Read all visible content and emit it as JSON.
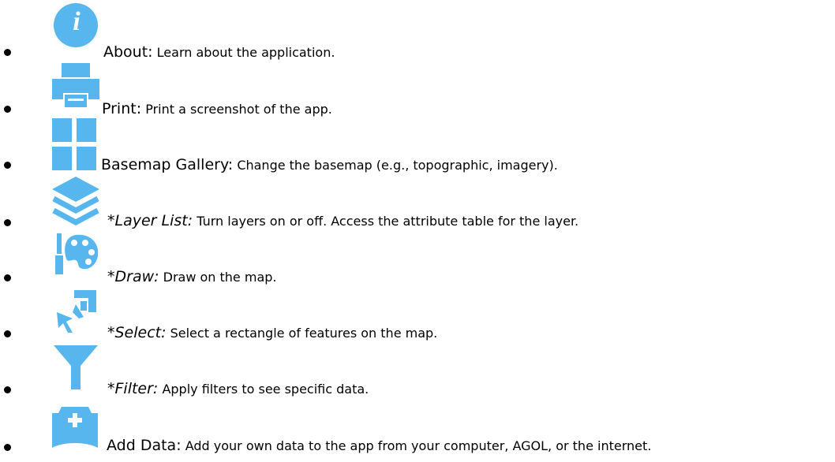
{
  "accent_color": "#58b6ef",
  "items": [
    {
      "icon": "info-icon",
      "name": "About:",
      "italic": false,
      "description": "Learn about the application."
    },
    {
      "icon": "print-icon",
      "name": "Print:",
      "italic": false,
      "description": "Print a screenshot of the app."
    },
    {
      "icon": "basemap-gallery-icon",
      "name": "Basemap Gallery:",
      "italic": false,
      "description": "Change the basemap (e.g., topographic, imagery)."
    },
    {
      "icon": "layers-icon",
      "name": "*Layer List:",
      "italic": true,
      "description": "Turn layers on or off. Access the attribute table for the layer."
    },
    {
      "icon": "draw-palette-icon",
      "name": "*Draw:",
      "italic": true,
      "description": "Draw on the map."
    },
    {
      "icon": "select-icon",
      "name": "*Select:",
      "italic": true,
      "description": "Select a rectangle of features on the map."
    },
    {
      "icon": "filter-icon",
      "name": "*Filter:",
      "italic": true,
      "description": "Apply filters to see specific data."
    },
    {
      "icon": "add-data-icon",
      "name": "Add Data:",
      "italic": false,
      "description": "Add your own data to the app from your computer, AGOL, or the internet."
    }
  ]
}
